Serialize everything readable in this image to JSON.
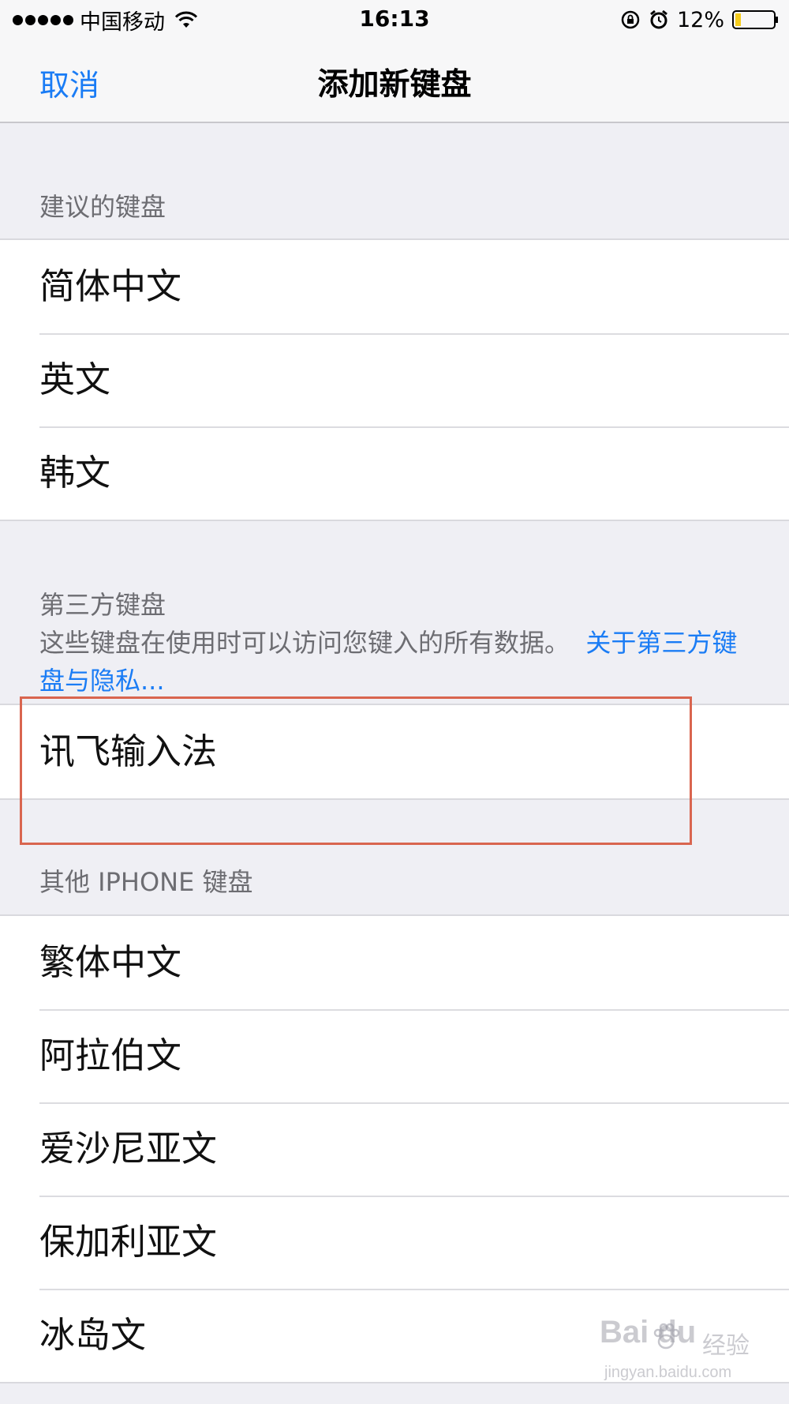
{
  "status_bar": {
    "carrier": "中国移动",
    "time": "16:13",
    "battery": "12%",
    "icons": [
      "signal-icon",
      "wifi-icon",
      "orientation-lock-icon",
      "alarm-icon",
      "battery-icon"
    ]
  },
  "nav": {
    "cancel": "取消",
    "title": "添加新键盘"
  },
  "suggested": {
    "header": "建议的键盘",
    "items": [
      "简体中文",
      "英文",
      "韩文"
    ]
  },
  "third_party": {
    "header": "第三方键盘",
    "description": "这些键盘在使用时可以访问您键入的所有数据。",
    "link_part1": "关于第",
    "link_part2": "三方键盘与隐私...",
    "items": [
      "讯飞输入法"
    ]
  },
  "other": {
    "header": "其他 IPHONE 键盘",
    "items": [
      "繁体中文",
      "阿拉伯文",
      "爱沙尼亚文",
      "保加利亚文",
      "冰岛文"
    ]
  },
  "watermark": {
    "logo_text": "Bai du",
    "cn": "经验",
    "url": "jingyan.baidu.com"
  },
  "colors": {
    "accent": "#1a7cf5",
    "highlight": "#d9654f",
    "battery": "#f5cc1c",
    "background": "#efeff4"
  }
}
